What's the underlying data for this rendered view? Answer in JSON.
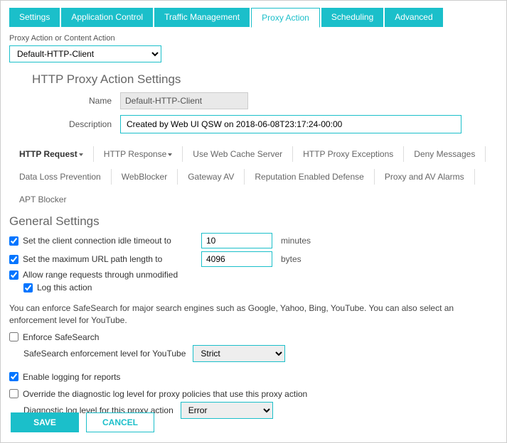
{
  "tabs": {
    "t0": "Settings",
    "t1": "Application Control",
    "t2": "Traffic Management",
    "t3": "Proxy Action",
    "t4": "Scheduling",
    "t5": "Advanced"
  },
  "top": {
    "label": "Proxy Action or Content Action",
    "value": "Default-HTTP-Client"
  },
  "section1_title": "HTTP Proxy Action Settings",
  "name_label": "Name",
  "name_value": "Default-HTTP-Client",
  "desc_label": "Description",
  "desc_value": "Created by Web UI QSW on 2018-06-08T23:17:24-00:00",
  "subnav": {
    "s0": "HTTP Request",
    "s1": "HTTP Response",
    "s2": "Use Web Cache Server",
    "s3": "HTTP Proxy Exceptions",
    "s4": "Deny Messages",
    "s5": "Data Loss Prevention",
    "s6": "WebBlocker",
    "s7": "Gateway AV",
    "s8": "Reputation Enabled Defense",
    "s9": "Proxy and AV Alarms",
    "s10": "APT Blocker"
  },
  "gs_title": "General Settings",
  "gs": {
    "idle_label": "Set the client connection idle timeout to",
    "idle_value": "10",
    "idle_unit": "minutes",
    "url_label": "Set the maximum URL path length to",
    "url_value": "4096",
    "url_unit": "bytes",
    "range_label": "Allow range requests through unmodified",
    "log_label": "Log this action"
  },
  "ss_paragraph": "You can enforce SafeSearch for major search engines such as Google, Yahoo, Bing, YouTube. You can also select an enforcement level for YouTube.",
  "ss": {
    "enforce_label": "Enforce SafeSearch",
    "level_label": "SafeSearch enforcement level for YouTube",
    "level_value": "Strict"
  },
  "rep": {
    "enable_reports": "Enable logging for reports",
    "override_label": "Override the diagnostic log level for proxy policies that use this proxy action",
    "diag_label": "Diagnostic log level for this proxy action",
    "diag_value": "Error"
  },
  "buttons": {
    "save": "SAVE",
    "cancel": "CANCEL"
  }
}
